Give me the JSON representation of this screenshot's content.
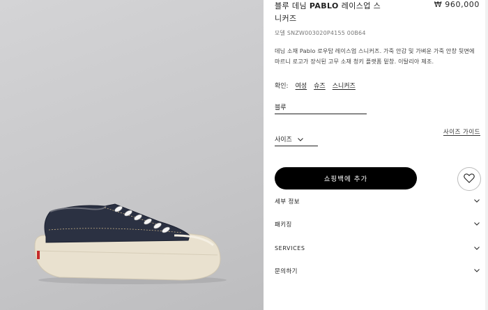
{
  "product": {
    "title_line1": "블루 데님 ",
    "title_bold": "PABLO",
    "title_line1_rest": " 레이스업 스",
    "title_line2": "니커즈",
    "price": "₩ 960,000",
    "model": "모델 SNZW003020P4155 00B64",
    "description": "데님 소재 Pablo 로우탑 레이스업 스니커즈. 가죽 안감 및 가벼운 가죽 안창 뒷면에 마르니 로고가 장식된 고무 소재 청키 플랫폼 밑창. 이탈리아 제조."
  },
  "confirm": {
    "label": "확인:",
    "links": [
      "여성",
      "슈즈",
      "스니커즈"
    ]
  },
  "color": {
    "value": "블루"
  },
  "size": {
    "label": "사이즈",
    "guide": "사이즈 가이드"
  },
  "cart": {
    "add_label": "쇼핑백에 추가"
  },
  "accordion": [
    "세부 정보",
    "패키징",
    "SERVICES",
    "문의하기"
  ],
  "icons": {
    "wishlist": "heart-icon",
    "chevron": "chevron-down-icon"
  },
  "colors": {
    "button_bg": "#000000",
    "image_bg": "#c8c8ca",
    "denim": "#2b3142",
    "sole": "#e8e0cf"
  }
}
